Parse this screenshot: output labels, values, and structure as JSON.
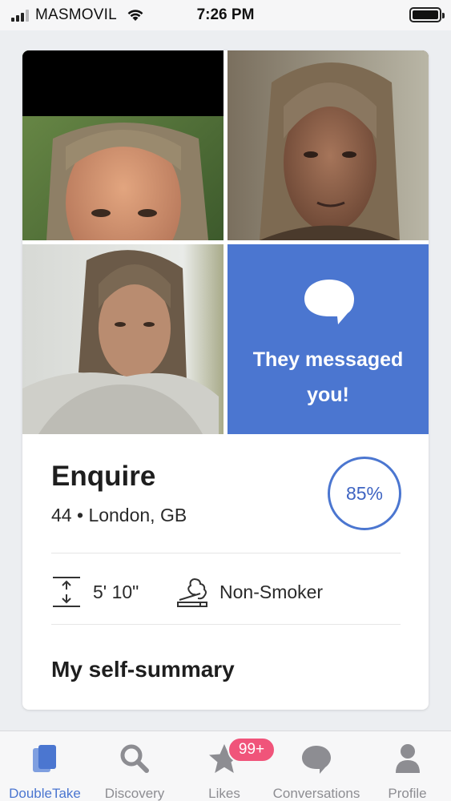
{
  "status_bar": {
    "carrier": "MASMOVIL",
    "time": "7:26 PM"
  },
  "profile": {
    "photos": [
      {
        "name": "photo-1",
        "alt": "Profile photo 1"
      },
      {
        "name": "photo-2",
        "alt": "Profile photo 2"
      },
      {
        "name": "photo-3",
        "alt": "Profile photo 3"
      }
    ],
    "message_tile": {
      "icon": "speech-bubble-icon",
      "text": "They messaged you!",
      "color": "#4b76d0"
    },
    "name": "Enquire",
    "age": "44",
    "separator": "•",
    "location": "London, GB",
    "match_percent": "85%",
    "details": {
      "height": "5' 10\"",
      "smoking": "Non-Smoker"
    },
    "section_title": "My self-summary"
  },
  "tabs": [
    {
      "label": "DoubleTake",
      "icon": "cards-icon",
      "active": true
    },
    {
      "label": "Discovery",
      "icon": "search-icon",
      "active": false
    },
    {
      "label": "Likes",
      "icon": "star-icon",
      "active": false,
      "badge": "99+"
    },
    {
      "label": "Conversations",
      "icon": "chat-bubble-icon",
      "active": false
    },
    {
      "label": "Profile",
      "icon": "person-icon",
      "active": false
    }
  ],
  "colors": {
    "accent": "#4b76d0",
    "badge": "#f0547a",
    "inactive": "#8d8d92"
  }
}
